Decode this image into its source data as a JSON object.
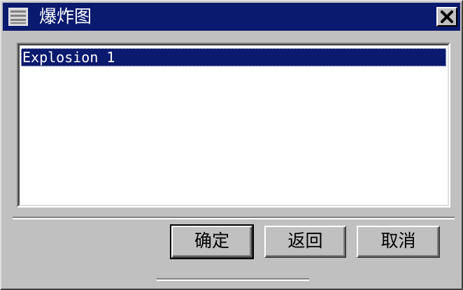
{
  "window": {
    "title": "爆炸图",
    "menu_icon": "menu-icon",
    "close_icon": "close-icon"
  },
  "list": {
    "items": [
      {
        "label": "Explosion 1",
        "selected": true
      }
    ]
  },
  "buttons": {
    "ok_label": "确定",
    "back_label": "返回",
    "cancel_label": "取消"
  },
  "colors": {
    "title_bar": "#0a1a6e",
    "selection": "#0a1a6e",
    "face": "#c0c0c0"
  }
}
